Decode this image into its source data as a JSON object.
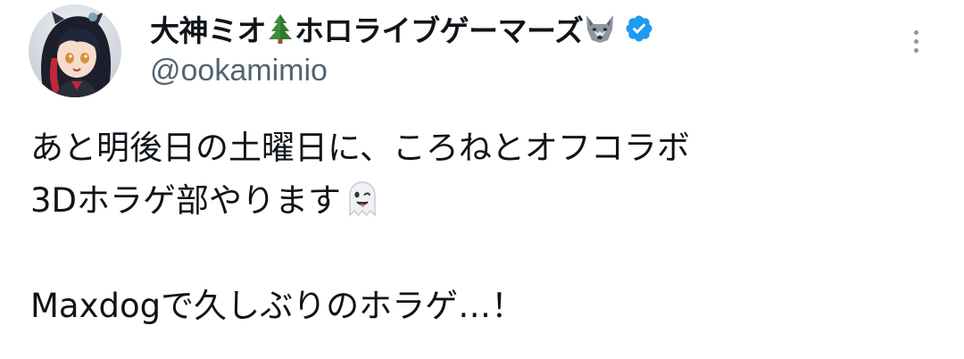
{
  "author": {
    "display_name_parts": [
      "大神ミオ",
      "ホロライブゲーマーズ"
    ],
    "name_emoji_1": "evergreen-tree-icon",
    "name_emoji_2": "wolf-face-icon",
    "verified": true,
    "verified_color": "#1d9bf0",
    "handle": "@ookamimio"
  },
  "tweet": {
    "lines": [
      "あと明後日の土曜日に、ころねとオフコラボ",
      "3Dホラゲ部やります",
      "",
      "Maxdogで久しぶりのホラゲ…！"
    ],
    "emoji_after_line_2": "ghost-icon"
  },
  "colors": {
    "text_primary": "#0f1419",
    "text_secondary": "#536471",
    "accent": "#1d9bf0"
  },
  "menu": {
    "icon": "more-vertical-icon"
  }
}
